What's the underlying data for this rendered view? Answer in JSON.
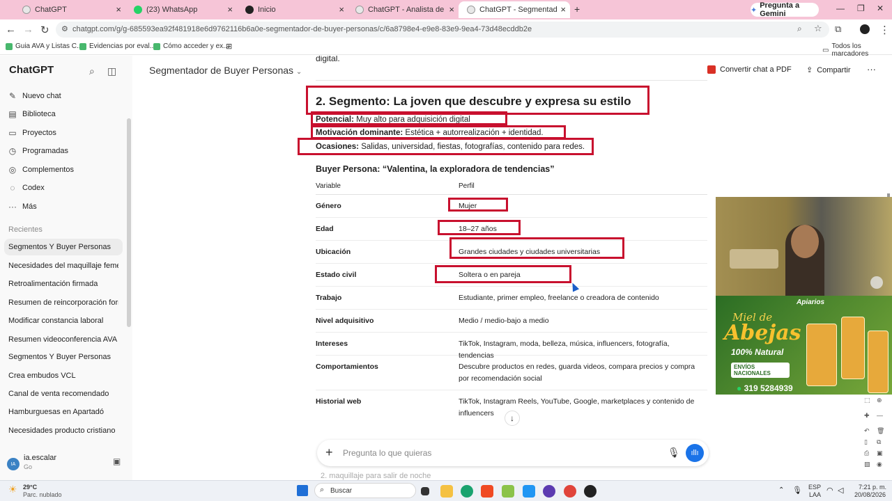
{
  "browser": {
    "tabs": [
      {
        "label": "ChatGPT",
        "active": false
      },
      {
        "label": "(23) WhatsApp",
        "active": false
      },
      {
        "label": "Inicio",
        "active": false
      },
      {
        "label": "ChatGPT - Analista de Productos",
        "active": false
      },
      {
        "label": "ChatGPT - Segmentador de Buy",
        "active": true
      }
    ],
    "gemini_label": "Pregunta a Gemini",
    "url": "chatgpt.com/g/g-685593ea92f481918e6d9762116b6a0e-segmentador-de-buyer-personas/c/6a8798e4-e9e8-83e9-9ea4-73d48ecddb2e",
    "bookmarks": [
      "Guia AVA y Listas C...",
      "Evidencias por eval...",
      "Cómo acceder y ex..."
    ],
    "all_bookmarks": "Todos los marcadores"
  },
  "sidebar": {
    "logo": "ChatGPT",
    "menu": [
      {
        "label": "Nuevo chat",
        "icon": "edit-icon"
      },
      {
        "label": "Biblioteca",
        "icon": "library-icon"
      },
      {
        "label": "Proyectos",
        "icon": "folder-icon"
      },
      {
        "label": "Programadas",
        "icon": "clock-icon"
      },
      {
        "label": "Complementos",
        "icon": "plugin-icon"
      },
      {
        "label": "Codex",
        "icon": "codex-icon"
      },
      {
        "label": "Más",
        "icon": "more-icon"
      }
    ],
    "recent_header": "Recientes",
    "recents": [
      "Segmentos Y Buyer Personas",
      "Necesidades del maquillaje femenino",
      "Retroalimentación firmada",
      "Resumen de reincorporación form",
      "Modificar constancia laboral",
      "Resumen videoconferencia AVA",
      "Segmentos Y Buyer Personas",
      "Crea embudos VCL",
      "Canal de venta recomendado",
      "Hamburguesas en Apartadó",
      "Necesidades producto cristiano"
    ],
    "user": {
      "name": "ia.escalar",
      "plan": "Go",
      "initials": "IA"
    }
  },
  "header": {
    "gpt_title": "Segmentador de Buyer Personas",
    "pdf_action": "Convertir chat a PDF",
    "share": "Compartir"
  },
  "content": {
    "prev_text": "digital.",
    "segment_title": "2. Segmento: La joven que descubre y expresa su estilo",
    "potencial_label": "Potencial:",
    "potencial_value": " Muy alto para adquisición digital",
    "motivacion_label": "Motivación dominante:",
    "motivacion_value": " Estética + autorrealización + identidad.",
    "ocasiones_label": "Ocasiones:",
    "ocasiones_value": " Salidas, universidad, fiestas, fotografías, contenido para redes.",
    "persona_title": "Buyer Persona: “Valentina, la exploradora de tendencias”",
    "table_headers": [
      "Variable",
      "Perfil"
    ],
    "rows": [
      {
        "k": "Género",
        "v": "Mujer"
      },
      {
        "k": "Edad",
        "v": "18–27 años"
      },
      {
        "k": "Ubicación",
        "v": "Grandes ciudades y ciudades universitarias"
      },
      {
        "k": "Estado civil",
        "v": "Soltera o en pareja"
      },
      {
        "k": "Trabajo",
        "v": "Estudiante, primer empleo, freelance o creadora de contenido"
      },
      {
        "k": "Nivel adquisitivo",
        "v": "Medio / medio-bajo a medio"
      },
      {
        "k": "Intereses",
        "v": "TikTok, Instagram, moda, belleza, música, influencers, fotografía, tendencias"
      },
      {
        "k": "Comportamientos",
        "v": "Descubre productos en redes, guarda videos, compara precios y compra por recomendación social"
      },
      {
        "k": "Historial web",
        "v": "TikTok, Instagram Reels, YouTube, Google, marketplaces y contenido de influencers"
      }
    ],
    "under_composer": "2.  maquillaje para salir de noche"
  },
  "composer": {
    "placeholder": "Pregunta lo que quieras"
  },
  "ad": {
    "brand": "Apiarios",
    "line1": "Miel de",
    "line2": "Abejas",
    "line3": "100% Natural",
    "line4": "ENVÍOS NACIONALES",
    "phone": "319 5284939"
  },
  "taskbar": {
    "weather_temp": "29°C",
    "weather_desc": "Parc. nublado",
    "search": "Buscar",
    "lang1": "ESP",
    "lang2": "LAA",
    "time": "7:21 p. m.",
    "date": "20/08/2026"
  },
  "colors": {
    "highlight_box": "#c8102e",
    "tabbar": "#f6c5d7",
    "voice_button": "#1a73e8"
  }
}
